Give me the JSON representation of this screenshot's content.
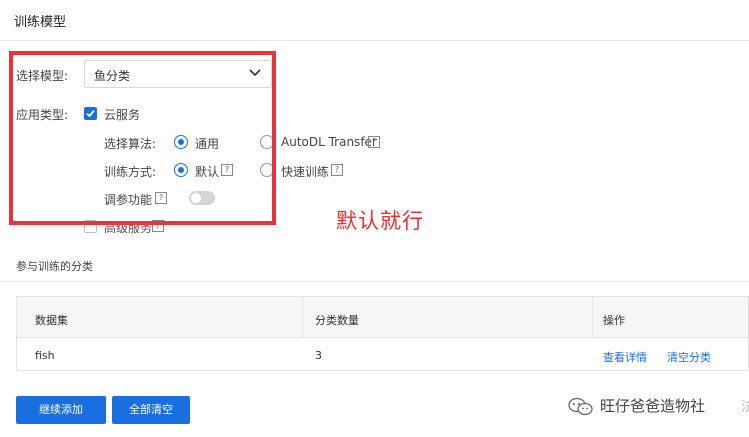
{
  "header": {
    "title": "训练模型"
  },
  "form": {
    "model_label": "选择模型:",
    "model_value": "鱼分类",
    "app_type_label": "应用类型:",
    "cloud_service_label": "云服务",
    "algorithm_label": "选择算法:",
    "algorithm_options": [
      "通用",
      "AutoDL Transfer"
    ],
    "algorithm_selected": "通用",
    "method_label": "训练方式:",
    "method_options": [
      "默认",
      "快速训练"
    ],
    "method_selected": "默认",
    "tuning_label": "调参功能",
    "tuning_enabled": false,
    "advanced_label": "高级服务",
    "help_glyph": "?"
  },
  "annotation": {
    "note": "默认就行",
    "color": "#e8353b"
  },
  "section": {
    "title": "参与训练的分类"
  },
  "table": {
    "headers": [
      "数据集",
      "分类数量",
      "操作"
    ],
    "rows": [
      {
        "dataset": "fish",
        "count": "3",
        "actions": [
          "查看详情",
          "清空分类"
        ]
      }
    ]
  },
  "buttons": {
    "continue_add": "继续添加",
    "clear_all": "全部清空"
  },
  "watermark": {
    "text": "旺仔爸爸造物社",
    "edge_char": "法"
  },
  "colors": {
    "accent": "#1a6fe0",
    "annotation_red": "#e8353b"
  }
}
